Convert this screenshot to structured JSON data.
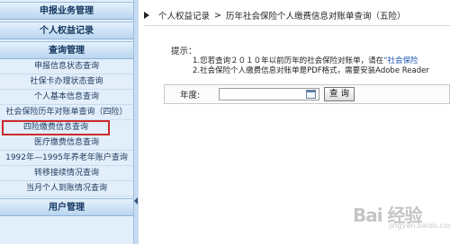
{
  "sidebar": {
    "sections": [
      {
        "label": "申报业务管理"
      },
      {
        "label": "个人权益记录"
      },
      {
        "label": "查询管理"
      },
      {
        "label": "用户管理"
      }
    ],
    "items": [
      {
        "label": "申报信息状态查询"
      },
      {
        "label": "社保卡办理状态查询"
      },
      {
        "label": "个人基本信息查询"
      },
      {
        "label": "社会保险历年对账单查询（四险）"
      },
      {
        "label": "四险缴费信息查询"
      },
      {
        "label": "医疗缴费信息查询"
      },
      {
        "label": "1992年—1995年养老年账户查询"
      },
      {
        "label": "转移接续情况查询"
      },
      {
        "label": "当月个人到账情况查询"
      }
    ]
  },
  "breadcrumb": {
    "items": [
      "个人权益记录",
      "历年社会保险个人缴费信息对账单查询（五险）"
    ],
    "separator": ">"
  },
  "tips": {
    "label": "提示：",
    "line1_prefix": "1.您若查询２０１０年以前历年的社会保险对账单，请在",
    "line1_link": "“社会保险",
    "line2": "2.社会保险个人缴费信息对账单是PDF格式，需要安装Adobe Reader"
  },
  "query": {
    "year_label": "年度:",
    "year_value": "",
    "button_label": "查 询"
  },
  "watermark": {
    "text": "Bai 经验",
    "url": "jingyan.baidu.com"
  },
  "colors": {
    "sidebar_bg": "#e2eefa",
    "header_text": "#13365e",
    "selected_border": "#cc2a2a",
    "link": "#1c55b3"
  }
}
